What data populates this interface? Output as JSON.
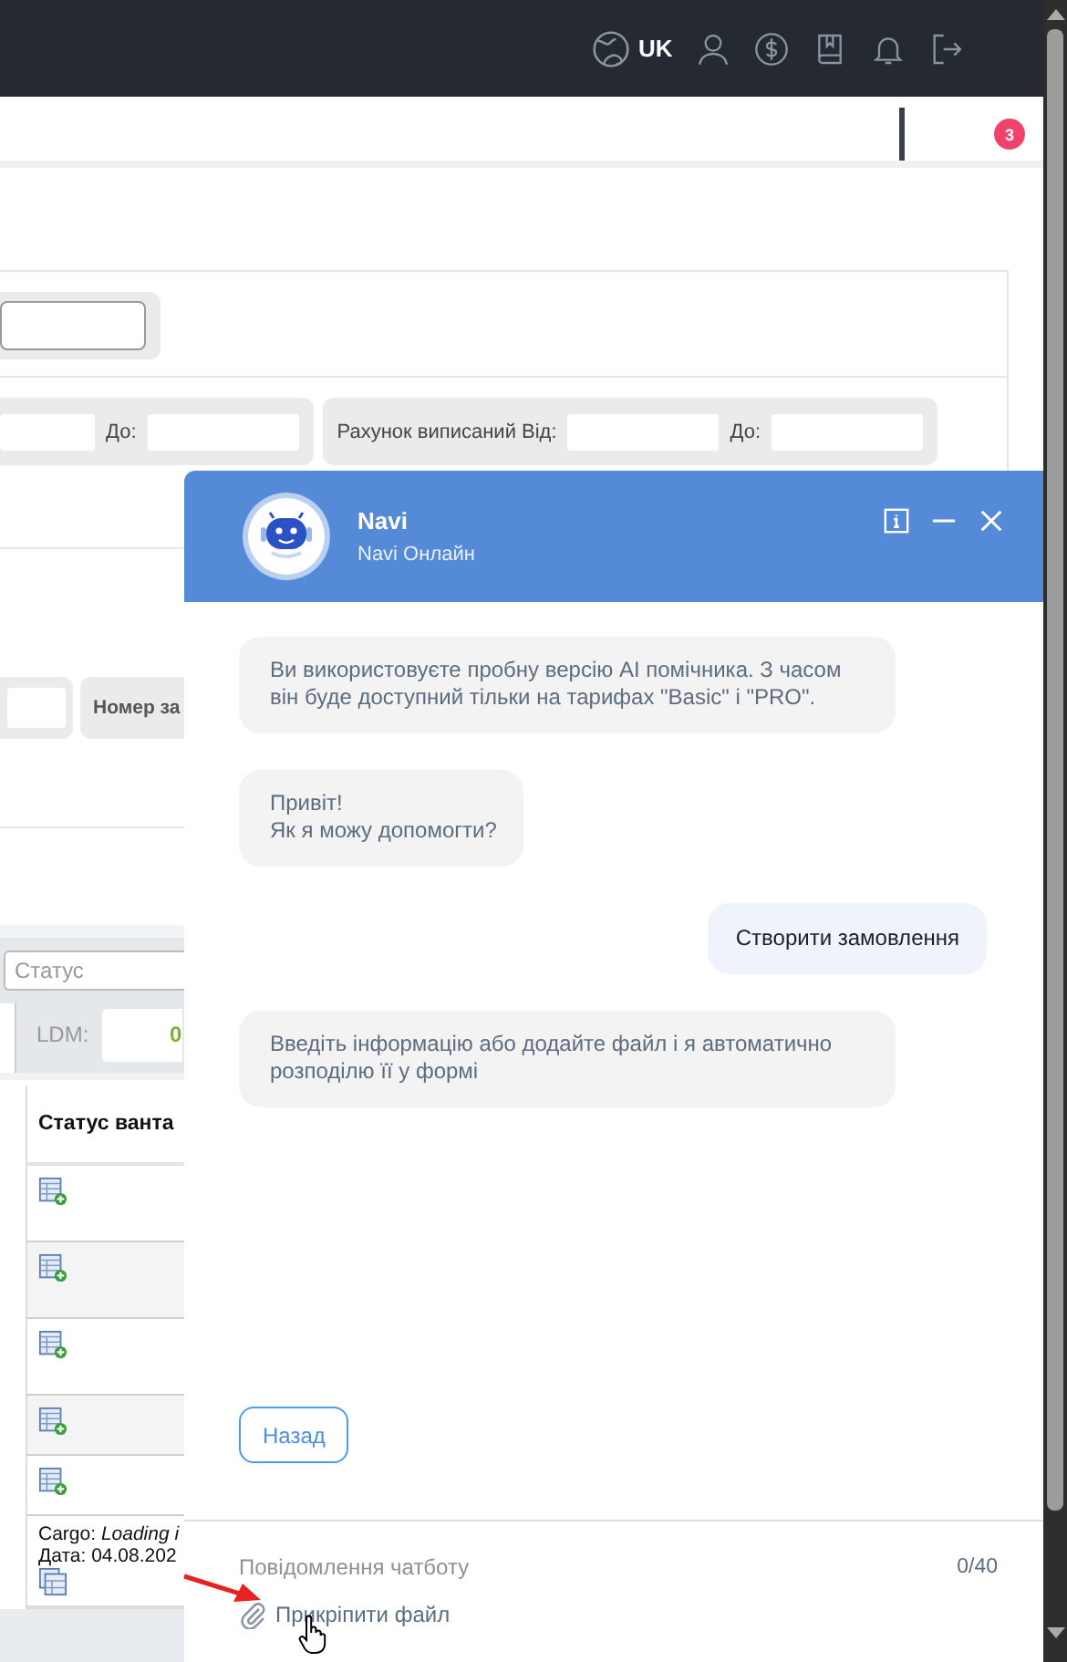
{
  "header": {
    "language": "UK"
  },
  "subbar": {
    "badge": "3"
  },
  "filter_rows": [
    {
      "groups": [
        {
          "items": [
            {
              "kind": "input"
            }
          ]
        }
      ]
    },
    {
      "groups": [
        {
          "items": [
            {
              "kind": "input"
            },
            {
              "kind": "label",
              "text": "До:"
            },
            {
              "kind": "input"
            }
          ]
        },
        {
          "items": [
            {
              "kind": "label",
              "text": "Рахунок виписаний Від:"
            },
            {
              "kind": "input"
            },
            {
              "kind": "label",
              "text": "До:"
            },
            {
              "kind": "input"
            }
          ]
        }
      ]
    },
    {
      "groups": [
        {
          "items": [
            {
              "kind": "input"
            }
          ]
        },
        {
          "items": [
            {
              "kind": "label",
              "text": "Номер за"
            }
          ]
        }
      ]
    }
  ],
  "table": {
    "status_filter": {
      "placeholder": "Статус"
    },
    "ldm": {
      "label": "LDM:",
      "value": "0"
    },
    "columns": [
      "Статус ванта"
    ],
    "rows": [
      {
        "kind": "icon"
      },
      {
        "kind": "icon"
      },
      {
        "kind": "icon"
      },
      {
        "kind": "icon"
      },
      {
        "kind": "icon"
      },
      {
        "kind": "text",
        "lines": [
          "Cargo: *Loading i*",
          "Дата: 04.08.202"
        ]
      }
    ]
  },
  "chat": {
    "title": "Navi",
    "status": "Navi Онлайн",
    "messages": [
      {
        "kind": "bot",
        "text": "Ви використовуєте пробну версію AI помічника. З часом він буде доступний тільки на тарифах \"Basic\" і \"PRO\"."
      },
      {
        "kind": "bot",
        "text": "Привіт!\nЯк я можу допомогти?"
      },
      {
        "kind": "user",
        "text": "Створити замовлення"
      },
      {
        "kind": "bot",
        "text": "Введіть інформацію або додайте файл і я автоматично розподілю її у формі"
      }
    ],
    "back_button": "Назад",
    "input": {
      "placeholder": "Повідомлення чатботу",
      "counter": "0/40"
    },
    "attach": "Прикріпити файл"
  }
}
